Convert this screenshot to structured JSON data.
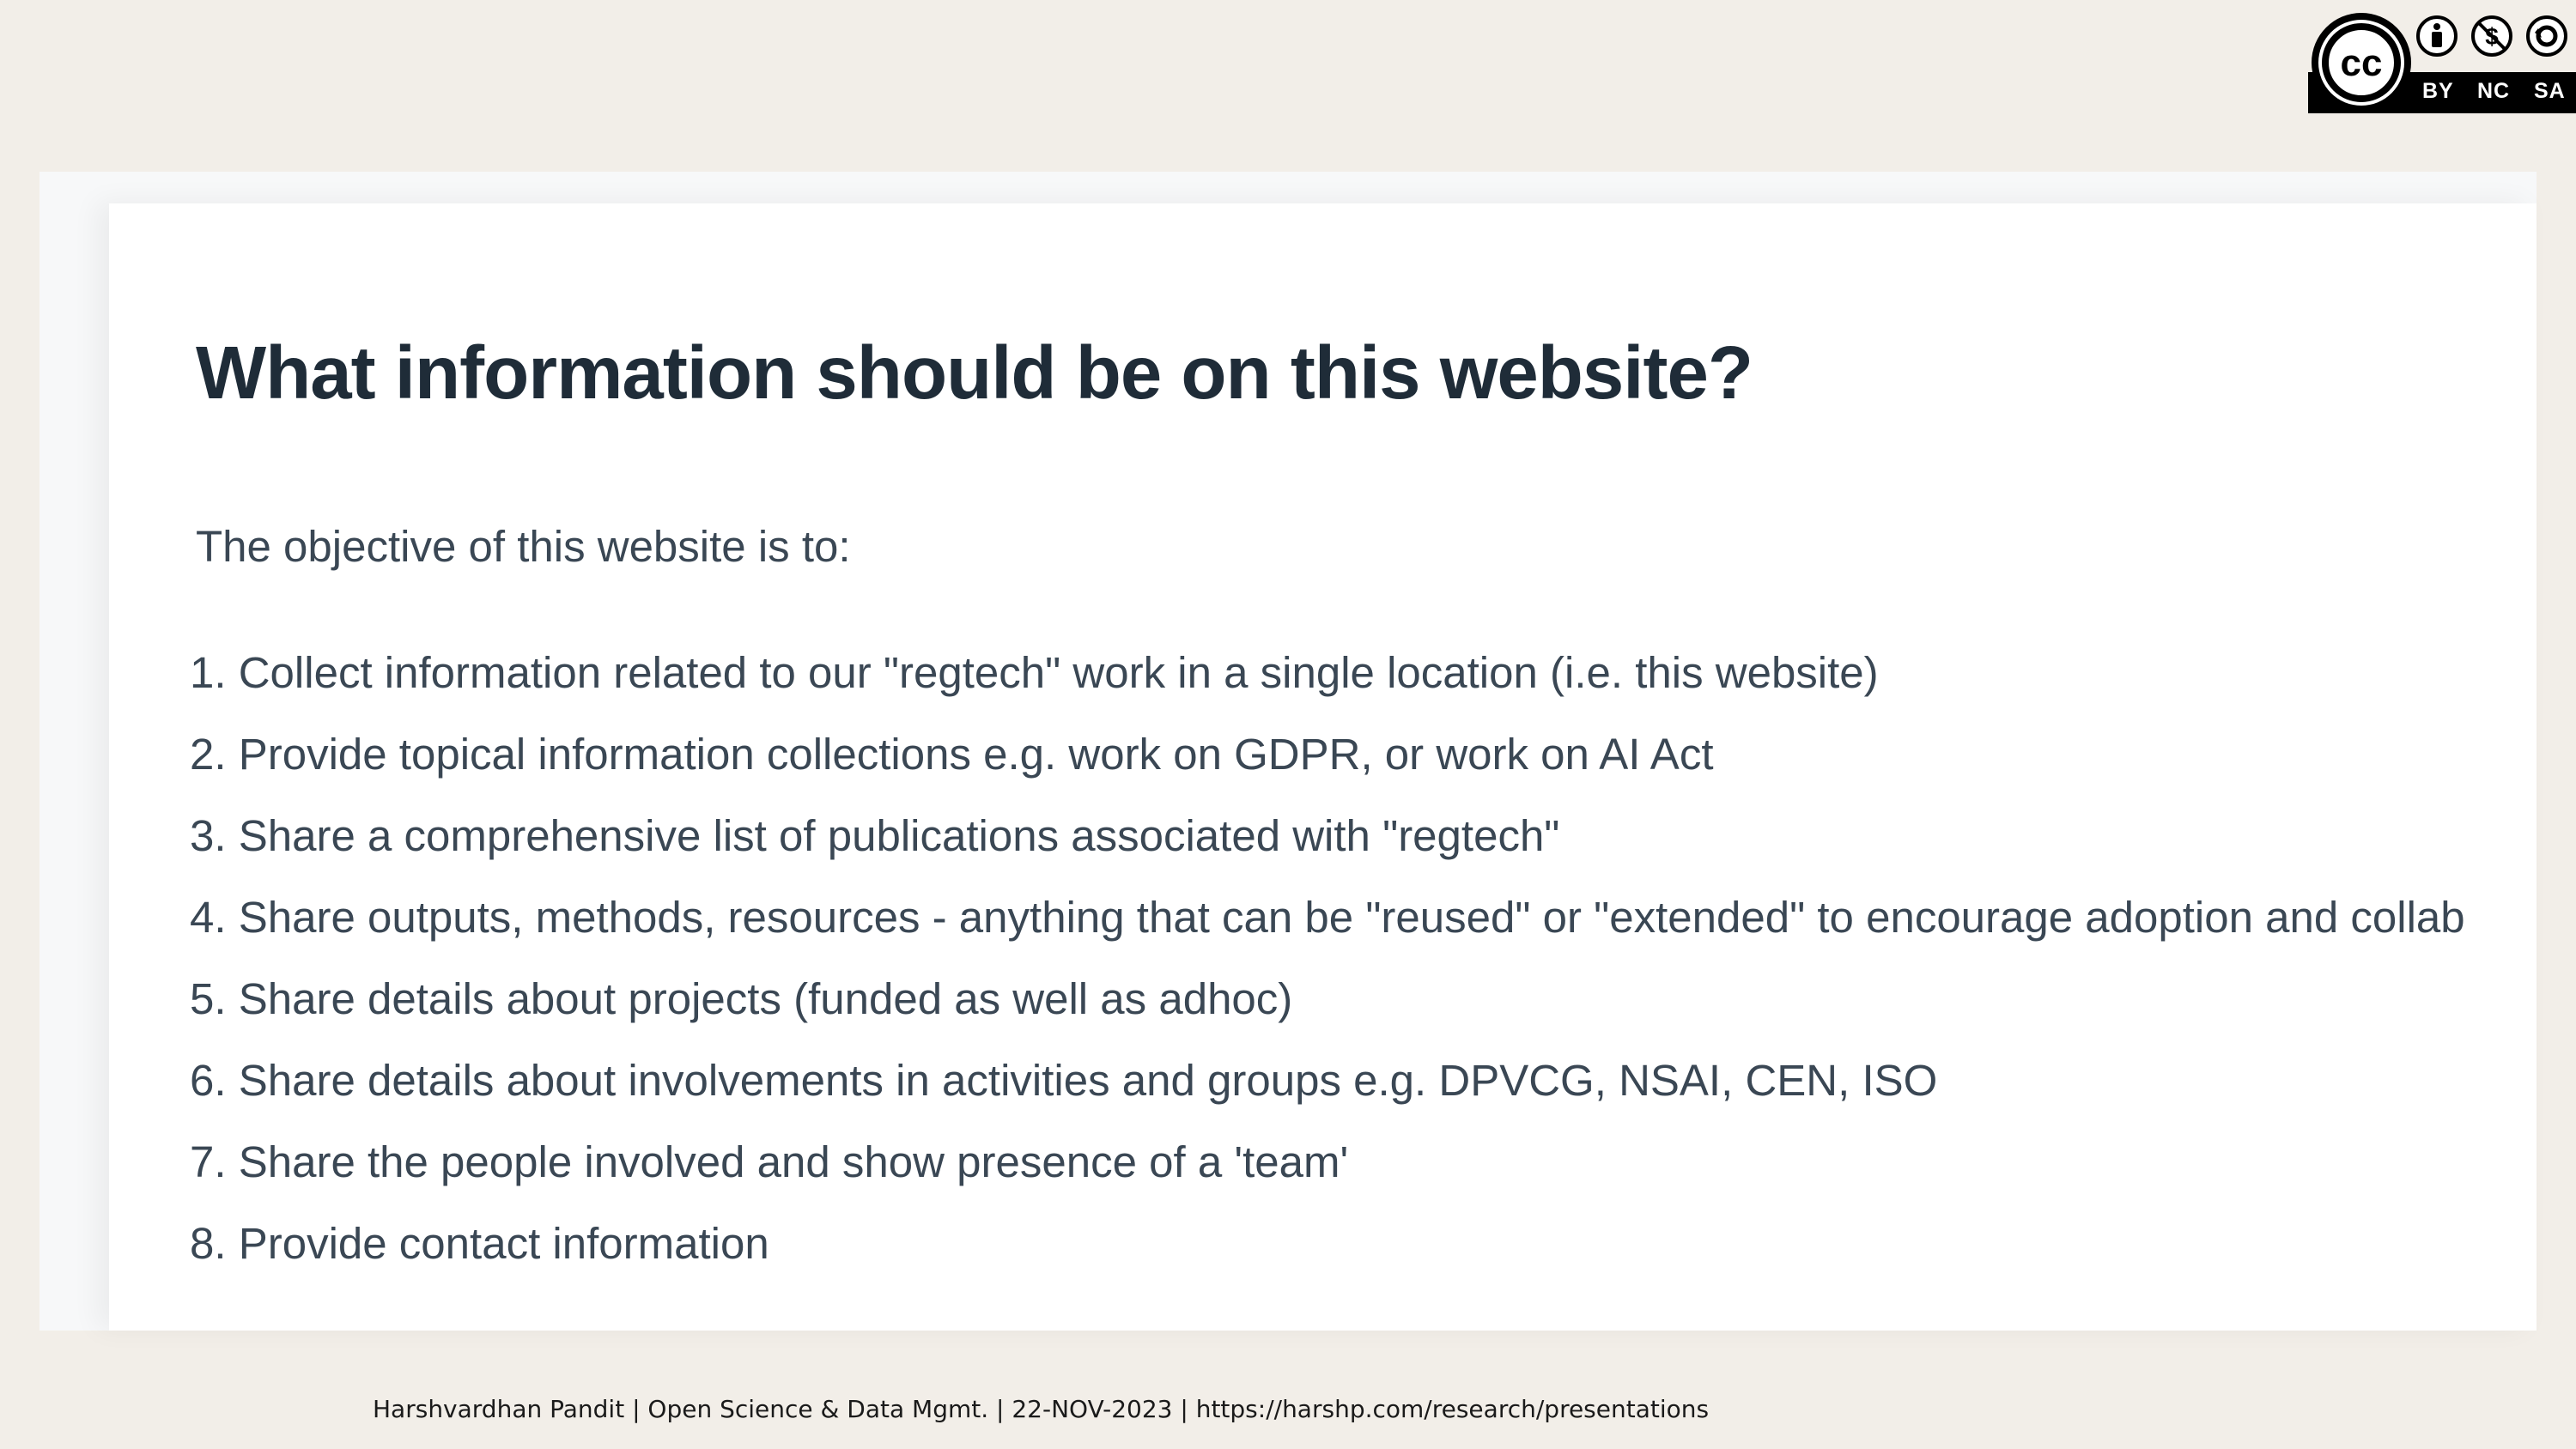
{
  "license": {
    "icon_name": "creative-commons-by-nc-sa-icon",
    "labels": [
      "BY",
      "NC",
      "SA"
    ]
  },
  "slide": {
    "title": "What information should be on this website?",
    "intro": "The objective of this website is to:",
    "objectives": [
      {
        "num": "1.",
        "text": "Collect information related to our \"regtech\" work in a single location (i.e. this website)"
      },
      {
        "num": "2.",
        "text": "Provide topical information collections e.g. work on GDPR, or work on AI Act"
      },
      {
        "num": "3.",
        "text": "Share a comprehensive list of publications associated with \"regtech\""
      },
      {
        "num": "4.",
        "text": "Share outputs, methods, resources - anything that can be \"reused\" or \"extended\" to encourage adoption and collab"
      },
      {
        "num": "5.",
        "text": "Share details about projects (funded as well as adhoc)"
      },
      {
        "num": "6.",
        "text": "Share details about involvements in activities and groups e.g. DPVCG, NSAI, CEN, ISO"
      },
      {
        "num": "7.",
        "text": "Share the people involved and show presence of a 'team'"
      },
      {
        "num": "8.",
        "text": "Provide contact information"
      }
    ]
  },
  "footer": "Harshvardhan Pandit | Open Science & Data Mgmt. | 22-NOV-2023 | https://harshp.com/research/presentations",
  "colors": {
    "background": "#f2eee8",
    "card": "#ffffff",
    "title": "#1f2c38",
    "body_text": "#3a4754"
  }
}
